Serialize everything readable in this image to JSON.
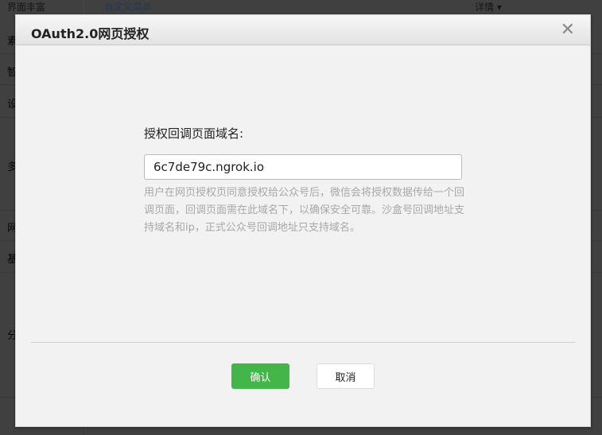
{
  "background": {
    "rows": [
      "界面丰富",
      "素",
      "智",
      "设",
      "多",
      "网",
      "基",
      "分"
    ],
    "menu_link": "自定义菜单",
    "detail_label": "详情 ▾"
  },
  "dialog": {
    "title": "OAuth2.0网页授权",
    "close_icon": "close-icon",
    "field_label": "授权回调页面域名:",
    "field_value": "6c7de79c.ngrok.io",
    "help_text": "用户在网页授权页同意授权给公众号后，微信会将授权数据传给一个回调页面，回调页面需在此域名下，以确保安全可靠。沙盒号回调地址支持域名和ip，正式公众号回调地址只支持域名。",
    "confirm_label": "确认",
    "cancel_label": "取消"
  },
  "colors": {
    "primary": "#44b549"
  }
}
